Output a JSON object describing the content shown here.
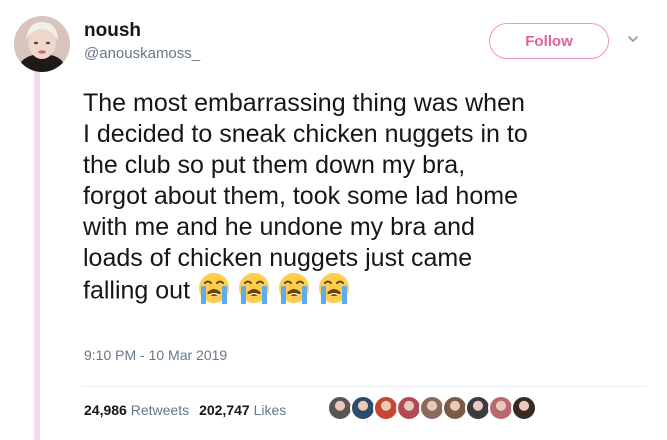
{
  "user": {
    "display_name": "noush",
    "handle": "@anouskamoss_",
    "avatar_icon": "profile-avatar"
  },
  "actions": {
    "follow_label": "Follow",
    "menu_icon": "chevron-down-icon",
    "accent_color": "#e0609e"
  },
  "tweet": {
    "lines": [
      "The most embarrassing thing was when",
      "I decided to sneak chicken nuggets in to",
      "the club so put them down my bra,",
      "forgot about them, took some lad home",
      "with me and he undone my bra and",
      "loads of chicken nuggets just came",
      "falling out"
    ],
    "emojis": [
      "loudly-crying-face",
      "loudly-crying-face",
      "loudly-crying-face",
      "loudly-crying-face"
    ],
    "timestamp": "9:10 PM - 10 Mar 2019"
  },
  "stats": {
    "retweet_count": "24,986",
    "retweet_label": "Retweets",
    "like_count": "202,747",
    "like_label": "Likes",
    "liker_avatar_colors": [
      "#5a5550",
      "#2f4a6a",
      "#c8452f",
      "#b04a55",
      "#8a6a5a",
      "#7a5b45",
      "#3b3b40",
      "#b46a70",
      "#3a2a25"
    ]
  }
}
